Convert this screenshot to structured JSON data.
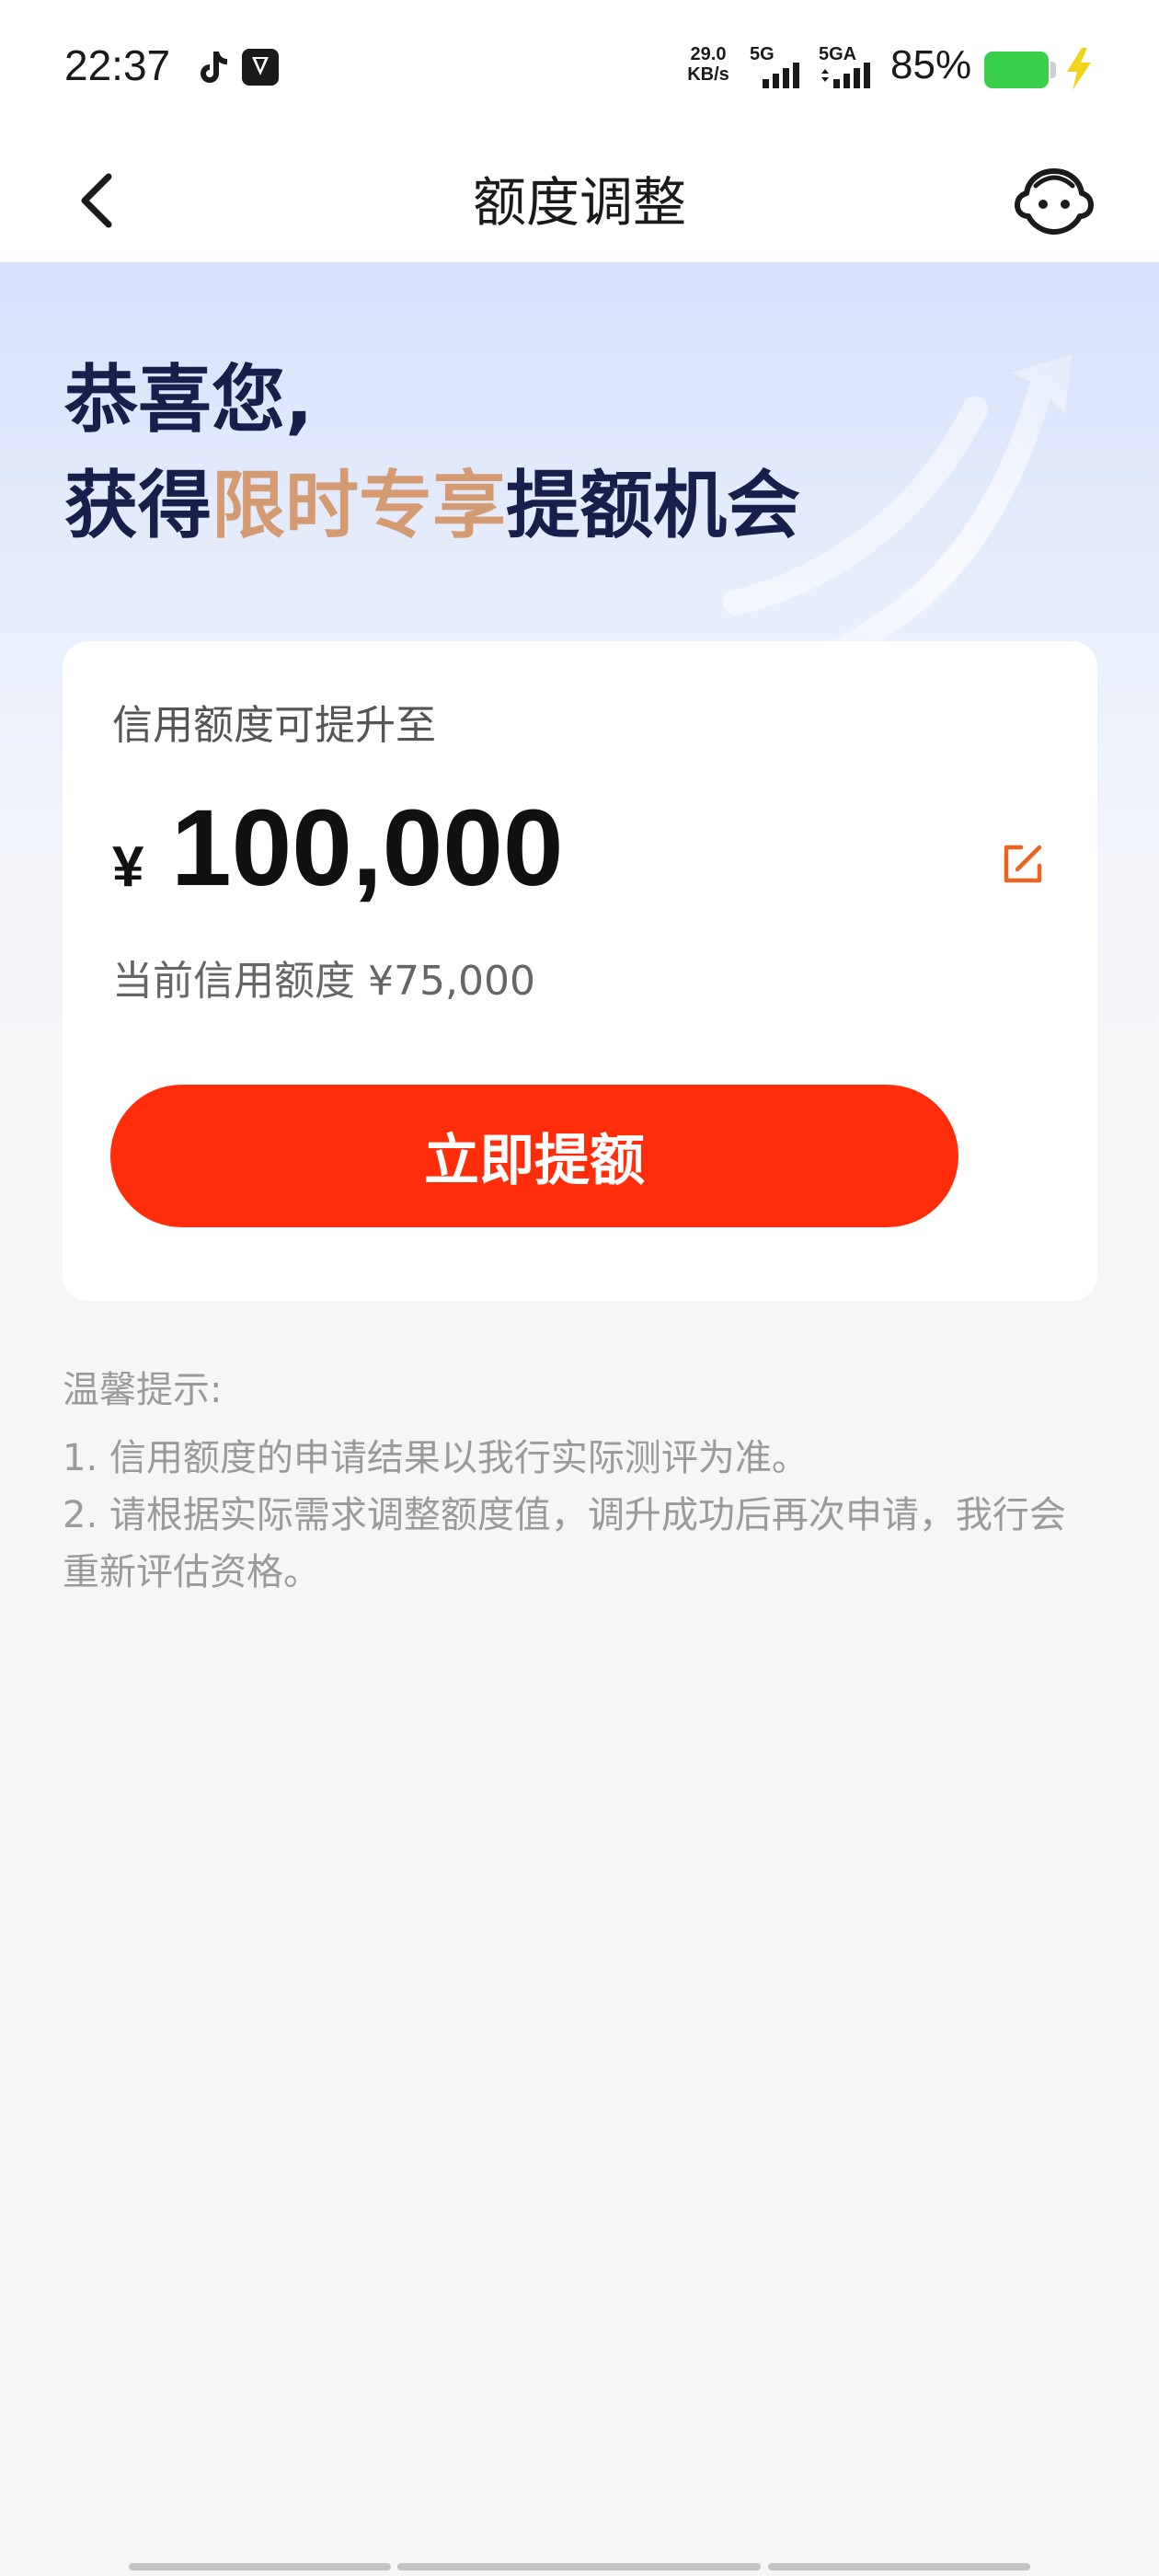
{
  "status_bar": {
    "time": "22:37",
    "net_speed_value": "29.0",
    "net_speed_unit": "KB/s",
    "sim1_label": "5G",
    "sim2_label": "5GA",
    "battery_percent": "85%",
    "battery_color": "#3ad04b"
  },
  "nav": {
    "title": "额度调整"
  },
  "hero": {
    "line1": "恭喜您,",
    "line2_prefix": "获得",
    "line2_highlight": "限时专享",
    "line2_suffix": "提额机会",
    "highlight_color": "#d49a72"
  },
  "card": {
    "label": "信用额度可提升至",
    "currency": "¥",
    "amount": "100,000",
    "current_limit_text": "当前信用额度 ¥75,000",
    "submit_label": "立即提额",
    "button_color": "#ff2d0a"
  },
  "tips": {
    "title": "温馨提示:",
    "items": [
      "1. 信用额度的申请结果以我行实际测评为准。",
      "2. 请根据实际需求调整额度值，调升成功后再次申请，我行会重新评估资格。"
    ]
  }
}
